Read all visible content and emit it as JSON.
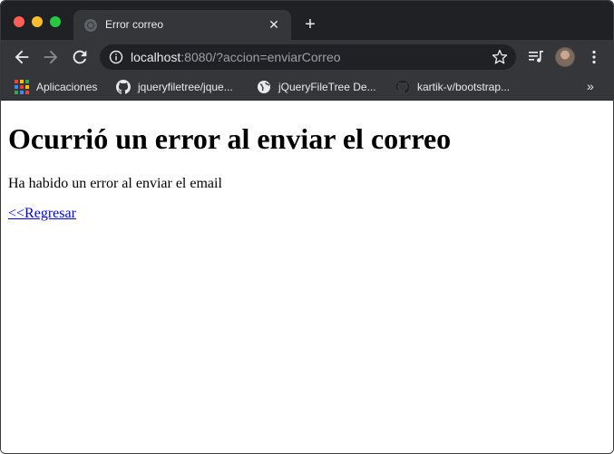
{
  "browser": {
    "tab": {
      "title": "Error correo",
      "close_symbol": "✕"
    },
    "new_tab_symbol": "+",
    "address_bar": {
      "host": "localhost",
      "rest": ":8080/?accion=enviarCorreo"
    },
    "bookmarks": [
      {
        "label": "Aplicaciones",
        "icon": "apps-grid-icon"
      },
      {
        "label": "jqueryfiletree/jque...",
        "icon": "github-icon"
      },
      {
        "label": "jQueryFileTree De...",
        "icon": "globe-icon"
      },
      {
        "label": "kartik-v/bootstrap...",
        "icon": "github-icon"
      }
    ],
    "bookmarks_overflow": "»",
    "colors": {
      "tabstrip": "#202124",
      "toolbar": "#35363a",
      "text": "#e8eaed",
      "url_muted": "#9aa0a6"
    }
  },
  "page": {
    "heading": "Ocurrió un error al enviar el correo",
    "message": "Ha habido un error al enviar el email",
    "back_link": "<<Regresar",
    "link_color": "#0000ee"
  }
}
